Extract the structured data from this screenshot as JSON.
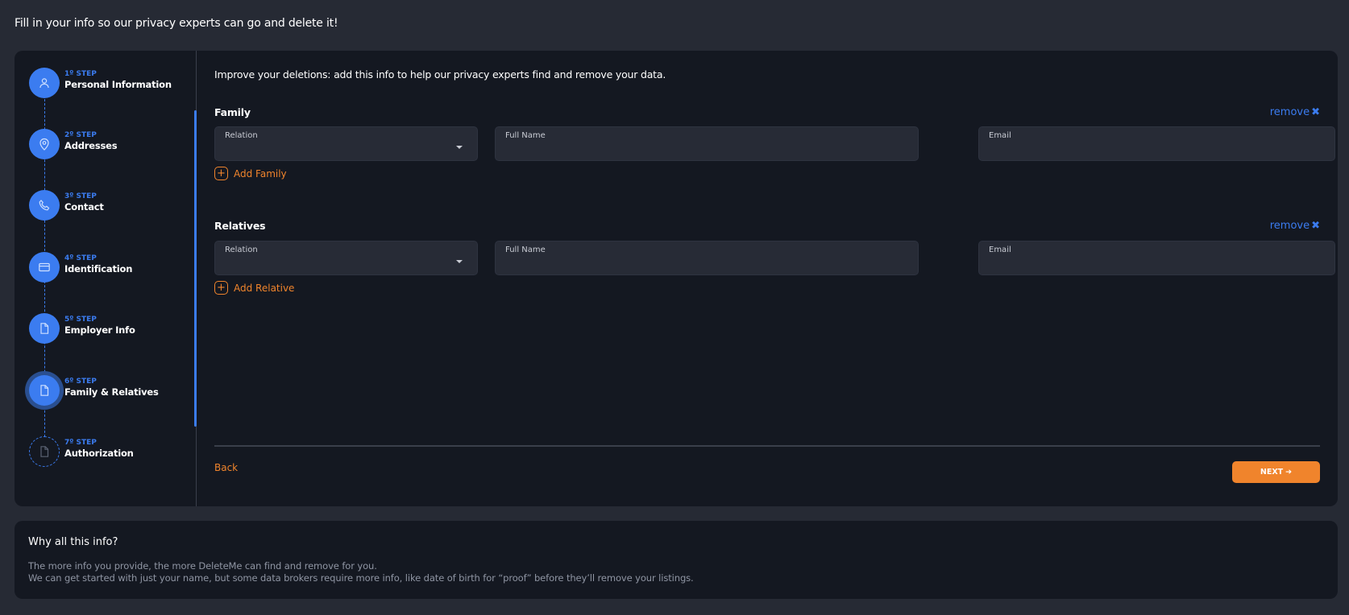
{
  "page": {
    "heading": "Fill in your info so our privacy experts can go and delete it!"
  },
  "steps": [
    {
      "num": "1º STEP",
      "label": "Personal Information",
      "icon": "user-icon",
      "state": "done"
    },
    {
      "num": "2º STEP",
      "label": "Addresses",
      "icon": "map-pin-icon",
      "state": "done"
    },
    {
      "num": "3º STEP",
      "label": "Contact",
      "icon": "phone-icon",
      "state": "done"
    },
    {
      "num": "4º STEP",
      "label": "Identification",
      "icon": "id-card-icon",
      "state": "done"
    },
    {
      "num": "5º STEP",
      "label": "Employer Info",
      "icon": "document-icon",
      "state": "done"
    },
    {
      "num": "6º STEP",
      "label": "Family & Relatives",
      "icon": "document-icon",
      "state": "active"
    },
    {
      "num": "7º STEP",
      "label": "Authorization",
      "icon": "document-icon",
      "state": "pending"
    }
  ],
  "main": {
    "intro": "Improve your deletions: add this info to help our privacy experts find and remove your data.",
    "family": {
      "title": "Family",
      "remove_label": "remove",
      "fields": {
        "relation": "Relation",
        "full_name": "Full Name",
        "email": "Email"
      },
      "add_label": "Add Family"
    },
    "relatives": {
      "title": "Relatives",
      "remove_label": "remove",
      "fields": {
        "relation": "Relation",
        "full_name": "Full Name",
        "email": "Email"
      },
      "add_label": "Add Relative"
    },
    "back_label": "Back",
    "next_label": "NEXT"
  },
  "info": {
    "title": "Why all this info?",
    "line1": "The more info you provide, the more DeleteMe can find and remove for you.",
    "line2": "We can get started with just your name, but some data brokers require more info, like date of birth for “proof” before they’ll remove your listings."
  },
  "colors": {
    "accent_blue": "#3b7cf0",
    "accent_orange": "#f0842c",
    "card_bg": "#141821",
    "page_bg": "#262a34"
  }
}
